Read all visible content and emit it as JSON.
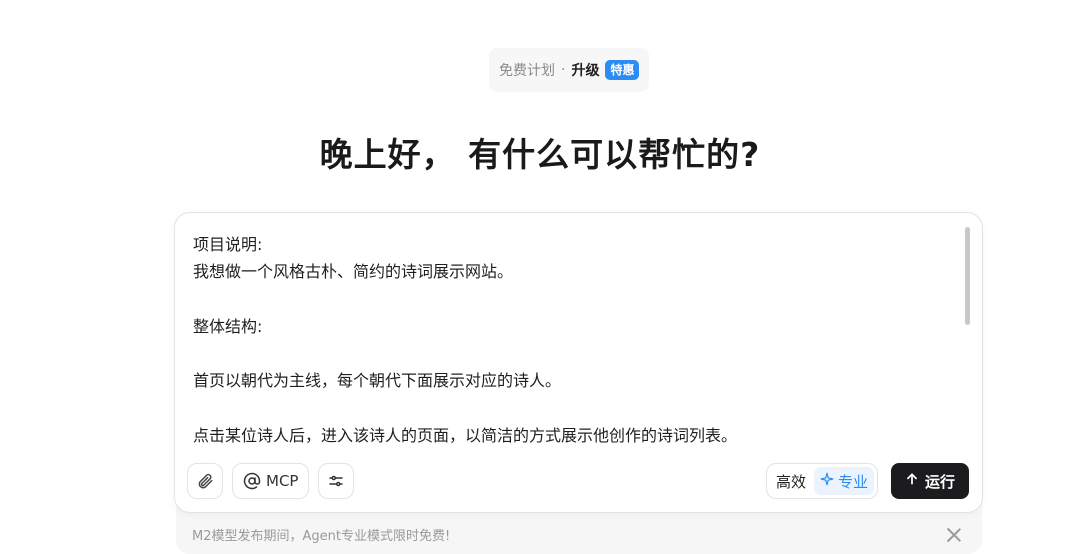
{
  "plan": {
    "free_label": "免费计划",
    "separator": "·",
    "upgrade_label": "升级",
    "badge": "特惠"
  },
  "greeting": "晚上好， 有什么可以帮忙的?",
  "prompt": {
    "text": "项目说明:\n我想做一个风格古朴、简约的诗词展示网站。\n\n整体结构:\n\n首页以朝代为主线，每个朝代下面展示对应的诗人。\n\n点击某位诗人后，进入该诗人的页面，以简洁的方式展示他创作的诗词列表。"
  },
  "toolbar": {
    "attach_icon": "paperclip-icon",
    "mcp_label": "MCP",
    "mcp_icon": "at-icon",
    "settings_icon": "sliders-icon",
    "modes": [
      {
        "label": "高效",
        "active": false
      },
      {
        "label": "专业",
        "active": true,
        "icon": "sparkle-icon"
      }
    ],
    "run_label": "运行",
    "run_icon": "arrow-up-icon"
  },
  "notice": {
    "text": "M2模型发布期间，Agent专业模式限时免费!",
    "close_icon": "close-icon"
  },
  "colors": {
    "accent": "#2b8cf5",
    "run_button": "#1c1c1e",
    "muted_text": "#9a9a9a"
  }
}
